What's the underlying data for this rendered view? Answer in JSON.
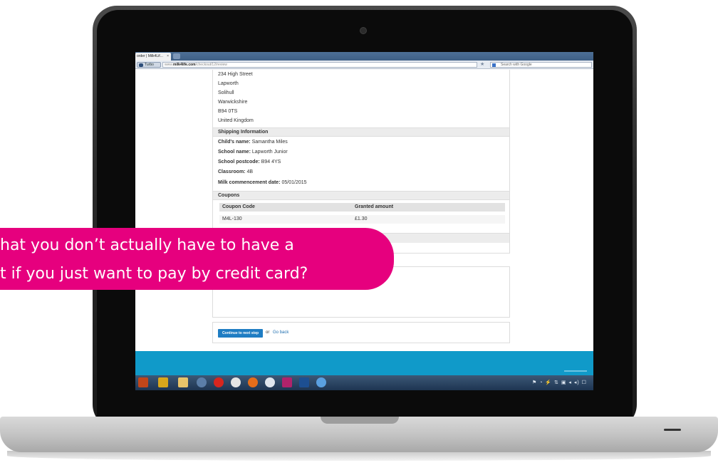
{
  "browser": {
    "tab_title": "order | Milk4Lif...",
    "tab_close": "×",
    "turbo_label": "Turbo",
    "url_prefix": "www.",
    "url_domain": "milk4life.com",
    "url_path": "/checkout/12/review",
    "star_glyph": "★",
    "search_placeholder": "Search with Google"
  },
  "address": {
    "lines": [
      "234 High Street",
      "Lapworth",
      "Solihull",
      "Warwickshire",
      "B94 0TS",
      "United Kingdom"
    ]
  },
  "shipping": {
    "header": "Shipping Information",
    "fields": [
      {
        "label": "Child's name:",
        "value": "Samantha Miles"
      },
      {
        "label": "School name:",
        "value": "Lapworth Junior"
      },
      {
        "label": "School postcode:",
        "value": "B94 4YS"
      },
      {
        "label": "Classroom:",
        "value": "4B"
      },
      {
        "label": "Milk commencement date:",
        "value": "05/01/2015"
      }
    ]
  },
  "coupons": {
    "header": "Coupons",
    "columns": [
      "Coupon Code",
      "Granted amount"
    ],
    "rows": [
      {
        "code": "M4L-130",
        "amount": "£1.30"
      }
    ]
  },
  "actions": {
    "continue_label": "Continue to next step",
    "or_text": "or",
    "go_back_label": "Go back"
  },
  "taskbar": {
    "tray_text": "⚑ ◔ ⚡ ⇅ ▣ ◂ ◂) ☐"
  },
  "bubble": {
    "line1": "hat you don’t actually have to have a",
    "line2": "t if you just want to pay by credit card?",
    "color": "#e6007e"
  },
  "colors": {
    "footer": "#109ac9",
    "button": "#1f7dc3"
  }
}
